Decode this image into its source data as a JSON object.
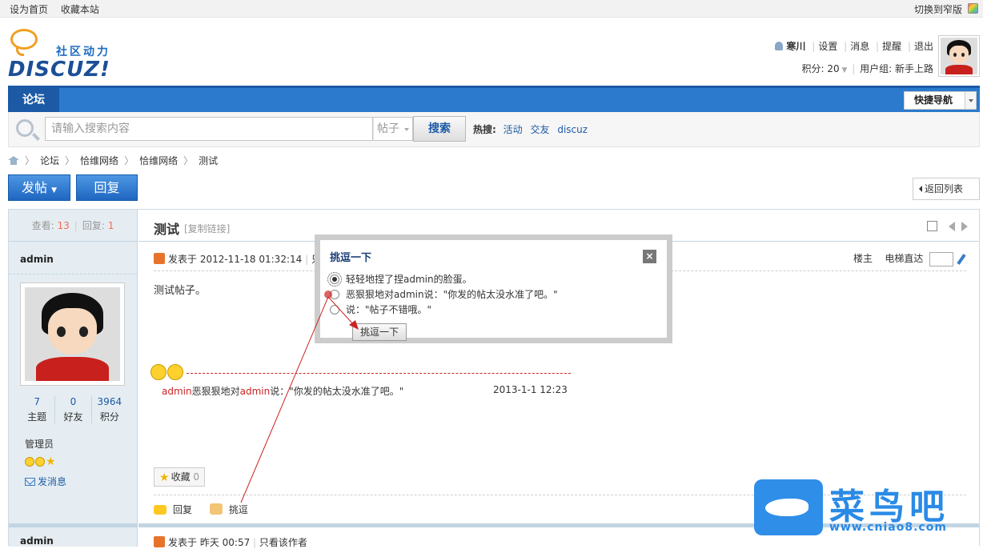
{
  "topbar": {
    "set_home": "设为首页",
    "bookmark": "收藏本站",
    "switch_width": "切换到窄版"
  },
  "logo": {
    "slogan": "社区动力",
    "brand": "DISCUZ!"
  },
  "user": {
    "name": "寒川",
    "settings": "设置",
    "messages": "消息",
    "reminders": "提醒",
    "logout": "退出",
    "points_label": "积分: 20",
    "usergroup": "用户组: 新手上路"
  },
  "nav": {
    "forum_tab": "论坛",
    "quick_nav": "快捷导航"
  },
  "search": {
    "placeholder": "请输入搜索内容",
    "type": "帖子",
    "button": "搜索",
    "hot_label": "热搜:",
    "hot": [
      "活动",
      "交友",
      "discuz"
    ]
  },
  "breadcrumb": [
    "论坛",
    "恰维网络",
    "恰维网络",
    "测试"
  ],
  "buttons": {
    "post": "发帖",
    "reply": "回复",
    "back": "返回列表"
  },
  "thread": {
    "views_label": "查看:",
    "views": "13",
    "replies_label": "回复:",
    "replies": "1",
    "title": "测试",
    "copy_link": "[复制链接]"
  },
  "author": {
    "name": "admin",
    "stats": [
      {
        "value": "7",
        "label": "主题"
      },
      {
        "value": "0",
        "label": "好友"
      },
      {
        "value": "3964",
        "label": "积分"
      }
    ],
    "role": "管理员",
    "send_msg": "发消息"
  },
  "post": {
    "posted": "发表于 2012-11-18 01:32:14",
    "sep": "只",
    "floor_label": "楼主",
    "jump_label": "电梯直达",
    "content": "测试帖子。",
    "tease_user": "admin",
    "tease_mid": "恶狠狠地对",
    "tease_user2": "admin",
    "tease_text": "说：\"你发的帖太没水准了吧。\"",
    "tease_time": "2013-1-1 12:23",
    "fav": "收藏",
    "fav_count": "0",
    "reply_action": "回复",
    "tease_action": "挑逗"
  },
  "post2": {
    "author": "admin",
    "posted": "发表于 昨天 00:57",
    "only_author": "只看该作者"
  },
  "dialog": {
    "title": "挑逗一下",
    "close": "×",
    "options": [
      "轻轻地捏了捏admin的脸蛋。",
      "恶狠狠地对admin说：\"你发的帖太没水准了吧。\"",
      "说：\"帖子不错哦。\""
    ],
    "button": "挑逗一下"
  },
  "watermark": {
    "text": "菜鸟吧",
    "url": "www.cniao8.com"
  }
}
